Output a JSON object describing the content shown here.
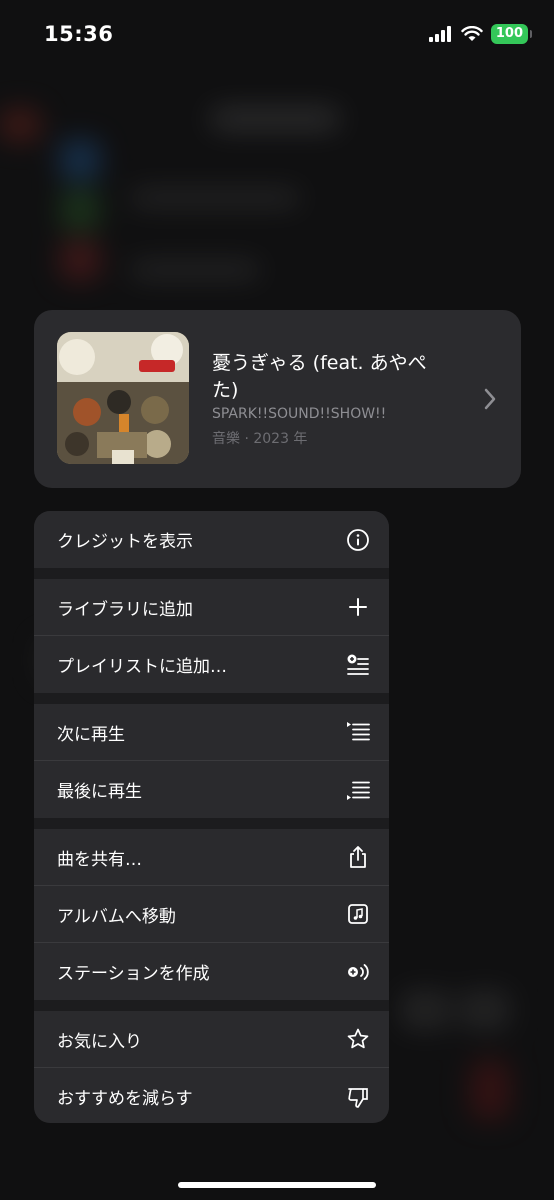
{
  "status_bar": {
    "time": "15:36",
    "battery": "100"
  },
  "song": {
    "title": "憂うぎゃる (feat. あやぺた)",
    "artist": "SPARK!!SOUND!!SHOW!!",
    "meta": "音樂 · 2023 年"
  },
  "menu": {
    "groups": [
      [
        {
          "label": "クレジットを表示",
          "icon": "info-icon"
        }
      ],
      [
        {
          "label": "ライブラリに追加",
          "icon": "plus-icon"
        },
        {
          "label": "プレイリストに追加…",
          "icon": "add-to-playlist-icon"
        }
      ],
      [
        {
          "label": "次に再生",
          "icon": "play-next-icon"
        },
        {
          "label": "最後に再生",
          "icon": "play-last-icon"
        }
      ],
      [
        {
          "label": "曲を共有…",
          "icon": "share-icon"
        },
        {
          "label": "アルバムへ移動",
          "icon": "album-icon"
        },
        {
          "label": "ステーションを作成",
          "icon": "station-icon"
        }
      ],
      [
        {
          "label": "お気に入り",
          "icon": "star-icon"
        },
        {
          "label": "おすすめを減らす",
          "icon": "thumbs-down-icon"
        }
      ]
    ]
  },
  "colors": {
    "background": "#141416",
    "card": "#2b2b2e",
    "menu": "#2a2a2d",
    "battery": "#34c759"
  }
}
